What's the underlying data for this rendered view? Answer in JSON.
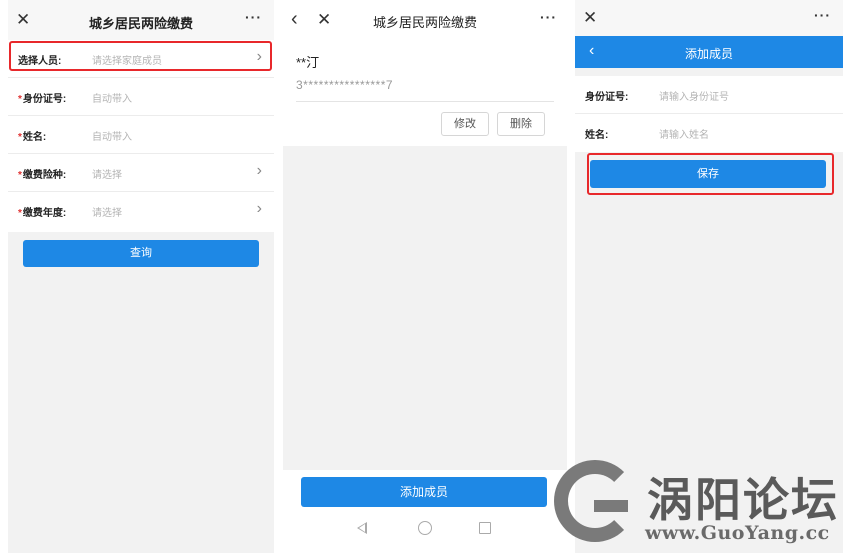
{
  "screen1": {
    "title": "城乡居民两险缴费",
    "close_icon": "×",
    "more_icon": "···",
    "rows": [
      {
        "label": "选择人员:",
        "placeholder": "请选择家庭成员",
        "required": false,
        "chevron": true
      },
      {
        "label": "身份证号:",
        "placeholder": "自动带入",
        "required": true,
        "chevron": false
      },
      {
        "label": "姓名:",
        "placeholder": "自动带入",
        "required": true,
        "chevron": false
      },
      {
        "label": "缴费险种:",
        "placeholder": "请选择",
        "required": true,
        "chevron": true
      },
      {
        "label": "缴费年度:",
        "placeholder": "请选择",
        "required": true,
        "chevron": true
      }
    ],
    "required_mark": "*",
    "query_button": "查询"
  },
  "screen2": {
    "title": "城乡居民两险缴费",
    "member_name": "**汀",
    "member_id": "3****************7",
    "edit_button": "修改",
    "delete_button": "删除",
    "add_button": "添加成员"
  },
  "screen3": {
    "header_title": "添加成员",
    "rows": [
      {
        "label": "身份证号:",
        "placeholder": "请输入身份证号"
      },
      {
        "label": "姓名:",
        "placeholder": "请输入姓名"
      }
    ],
    "save_button": "保存"
  },
  "watermark": {
    "cn": "涡阳论坛",
    "url": "www.GuoYang.cc"
  },
  "colors": {
    "primary": "#1e88e5",
    "highlight": "#e8282b",
    "required": "#e03333"
  }
}
